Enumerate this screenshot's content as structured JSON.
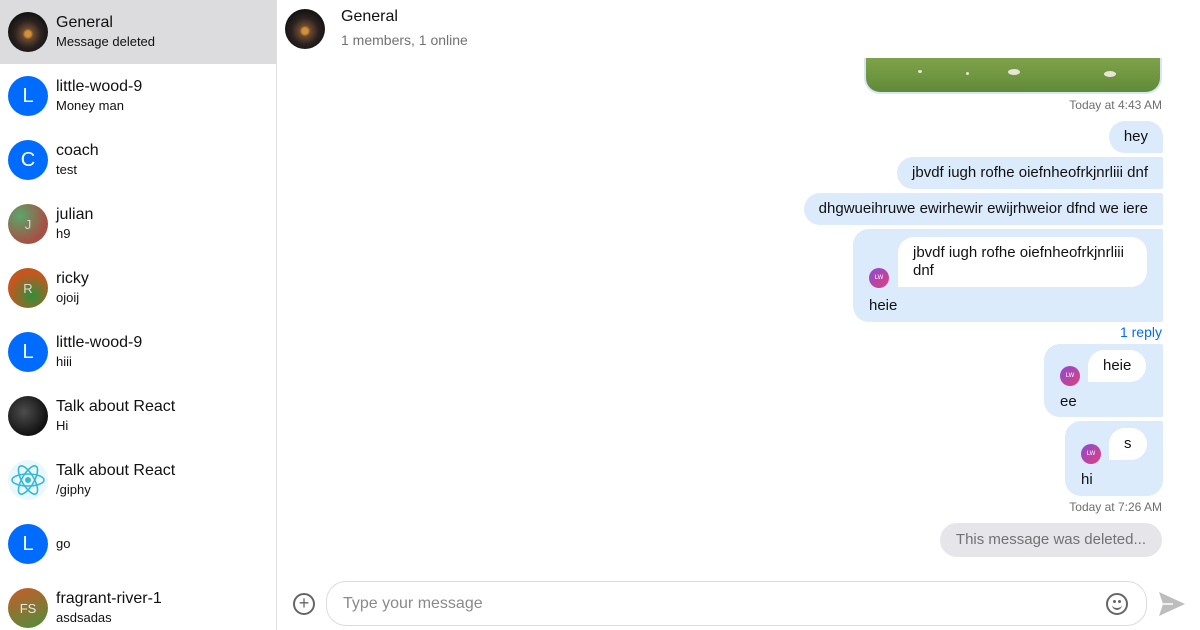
{
  "sidebar": {
    "channels": [
      {
        "name": "General",
        "preview": "Message deleted",
        "avatar": "photo",
        "active": true
      },
      {
        "name": "little-wood-9",
        "preview": "Money man",
        "avatar": "L"
      },
      {
        "name": "coach",
        "preview": "test",
        "avatar": "C"
      },
      {
        "name": "julian",
        "preview": "h9",
        "avatar": "J"
      },
      {
        "name": "ricky",
        "preview": "ojoij",
        "avatar": "R"
      },
      {
        "name": "little-wood-9",
        "preview": "hiii",
        "avatar": "L"
      },
      {
        "name": "Talk about React",
        "preview": "Hi",
        "avatar": "dark-photo"
      },
      {
        "name": "Talk about React",
        "preview": "/giphy",
        "avatar": "react-logo"
      },
      {
        "name": "",
        "preview": "go",
        "avatar": "L"
      },
      {
        "name": "fragrant-river-1",
        "preview": "asdsadas",
        "avatar": "FS"
      }
    ]
  },
  "header": {
    "title": "General",
    "subtitle": "1 members, 1 online"
  },
  "messages": {
    "ts1": "Today at 4:43 AM",
    "m1": "hey",
    "m2": "jbvdf iugh rofhe oiefnheofrkjnrliii dnf",
    "m3": "dhgwueihruwe ewirhewir ewijrhweior dfnd we iere",
    "m4_quote": "jbvdf iugh rofhe oiefnheofrkjnrliii dnf",
    "m4_text": "heie",
    "reply_link": "1 reply",
    "m5_quote": "heie",
    "m5_text": "ee",
    "m6_quote": "s",
    "m6_text": "hi",
    "ts2": "Today at 7:26 AM",
    "deleted": "This message was deleted...",
    "quote_avatar_initials": "LW"
  },
  "composer": {
    "placeholder": "Type your message"
  }
}
